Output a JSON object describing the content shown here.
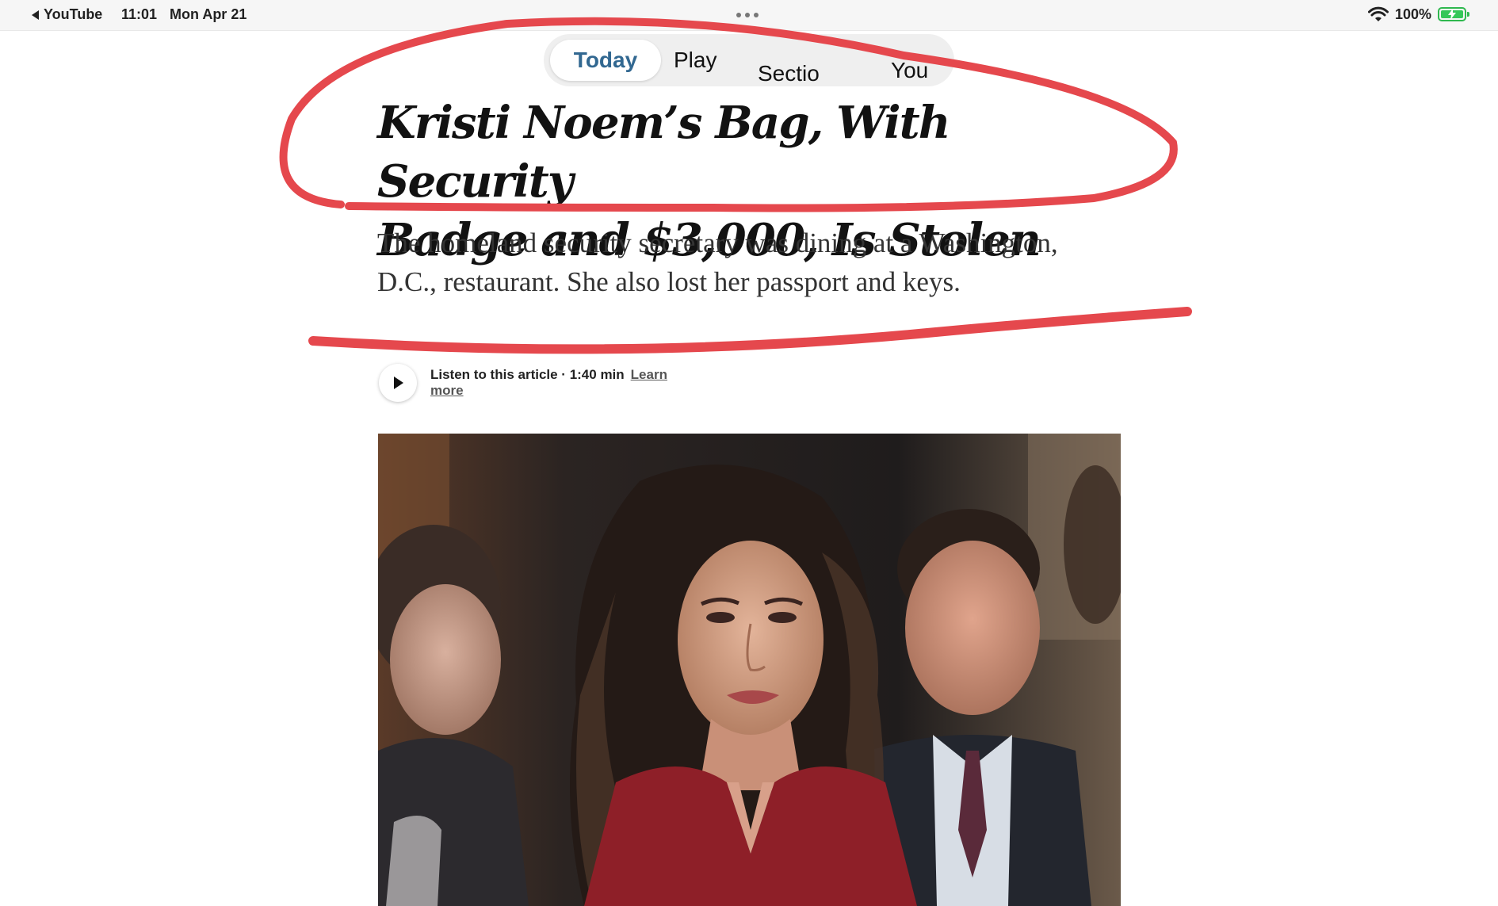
{
  "status_bar": {
    "back_app": "YouTube",
    "time": "11:01",
    "date": "Mon Apr 21",
    "battery": "100%"
  },
  "nav": {
    "tabs": [
      {
        "label": "Today",
        "active": true
      },
      {
        "label": "Play",
        "active": false
      },
      {
        "label": "Sectio",
        "active": false
      },
      {
        "label": "You",
        "active": false
      }
    ]
  },
  "article": {
    "headline_line1": "Kristi Noem’s Bag, With Security",
    "headline_line2": "Badge and $3,000, Is Stolen",
    "dek_line1": "The homeland security secretary was dining at a Washington,",
    "dek_line2": "D.C., restaurant. She also lost her passport and keys.",
    "listen_label": "Listen to this article · 1:40 min",
    "learn_more": "Learn more"
  },
  "colors": {
    "accent_blue": "#326891",
    "annotation_red": "#e5484d",
    "battery_green": "#35c759"
  }
}
